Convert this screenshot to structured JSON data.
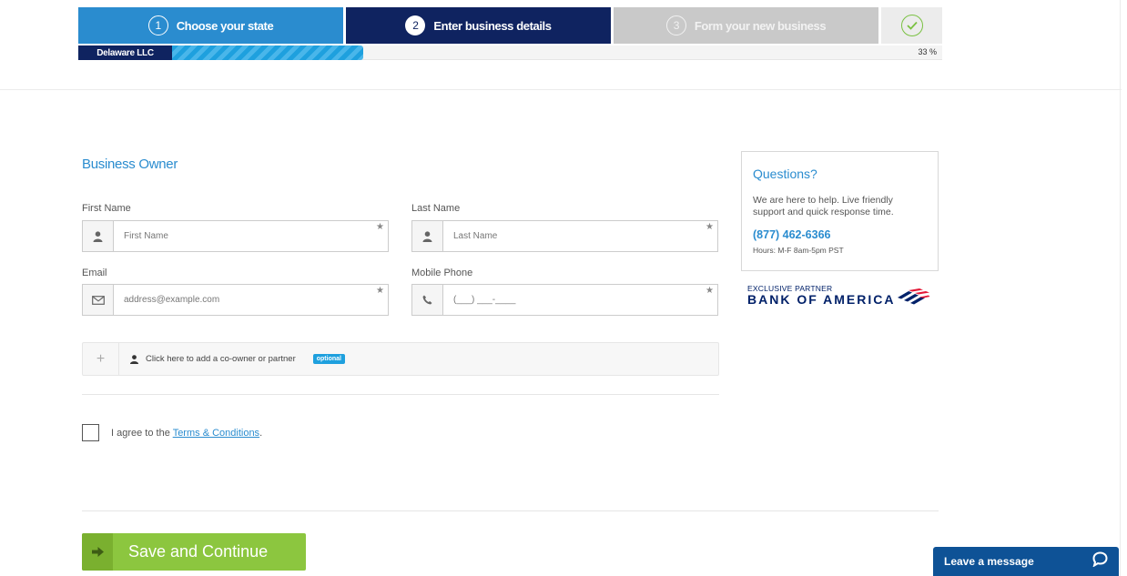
{
  "steps": [
    {
      "num": "1",
      "label": "Choose your state"
    },
    {
      "num": "2",
      "label": "Enter business details"
    },
    {
      "num": "3",
      "label": "Form your new business"
    }
  ],
  "progress": {
    "entity_label": "Delaware LLC",
    "percent_text": "33 %",
    "fraction": 0.33
  },
  "form": {
    "section_title": "Business Owner",
    "first_name": {
      "label": "First Name",
      "placeholder": "First Name"
    },
    "last_name": {
      "label": "Last Name",
      "placeholder": "Last Name"
    },
    "email": {
      "label": "Email",
      "placeholder": "address@example.com"
    },
    "mobile": {
      "label": "Mobile Phone",
      "placeholder": "(___) ___-____"
    },
    "required_mark": "★",
    "coowner": {
      "plus": "+",
      "text": "Click here to add a co-owner or partner",
      "badge": "optional"
    },
    "terms": {
      "prefix": "I agree to the ",
      "link": "Terms & Conditions",
      "suffix": "."
    },
    "save_label": "Save and Continue"
  },
  "questions": {
    "title": "Questions?",
    "text": "We are here to help. Live friendly support and quick response time.",
    "phone": "(877) 462-6366",
    "hours": "Hours: M-F 8am-5pm PST"
  },
  "partner": {
    "label": "EXCLUSIVE PARTNER",
    "name": "BANK OF AMERICA",
    "brand_color": "#012169",
    "flag_red": "#e31837"
  },
  "chat": {
    "label": "Leave a message"
  },
  "colors": {
    "accent": "#2a8ccf",
    "navy": "#0f2360",
    "green": "#8cc63f",
    "chat_blue": "#0e5296"
  }
}
